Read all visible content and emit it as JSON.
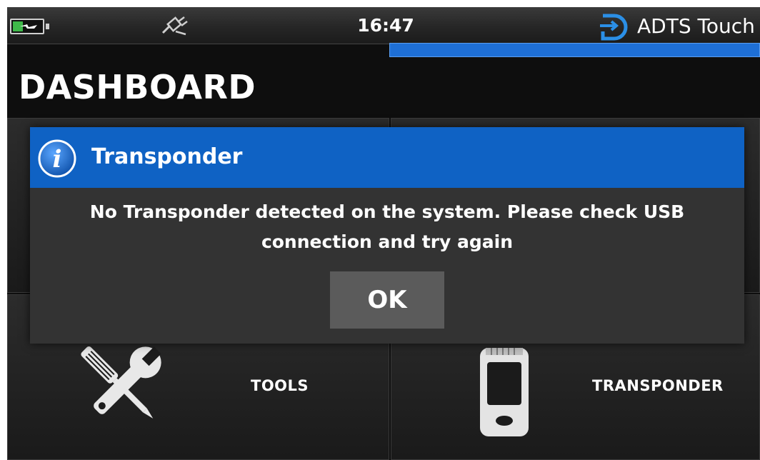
{
  "status_bar": {
    "time": "16:47",
    "brand": "ADTS Touch",
    "progress": 1.0,
    "icons": {
      "battery": "battery-charging-icon",
      "connection": "usb-disconnected-icon",
      "brand_logo": "adts-logo-icon"
    }
  },
  "page": {
    "title": "DASHBOARD"
  },
  "tiles": [
    {
      "label": "TOOLS",
      "icon": "tools-icon"
    },
    {
      "label": "TRANSPONDER",
      "icon": "transponder-icon"
    }
  ],
  "dialog": {
    "icon": "info-icon",
    "title": "Transponder",
    "message": "No Transponder detected on the system. Please check USB connection and try again",
    "ok_label": "OK"
  },
  "colors": {
    "accent_blue": "#0f62c4",
    "progress_blue": "#1e6fd6",
    "battery_green": "#3fb94a",
    "background": "#0e0e0e",
    "dialog_body": "#333333",
    "button_gray": "#5b5b5b"
  }
}
